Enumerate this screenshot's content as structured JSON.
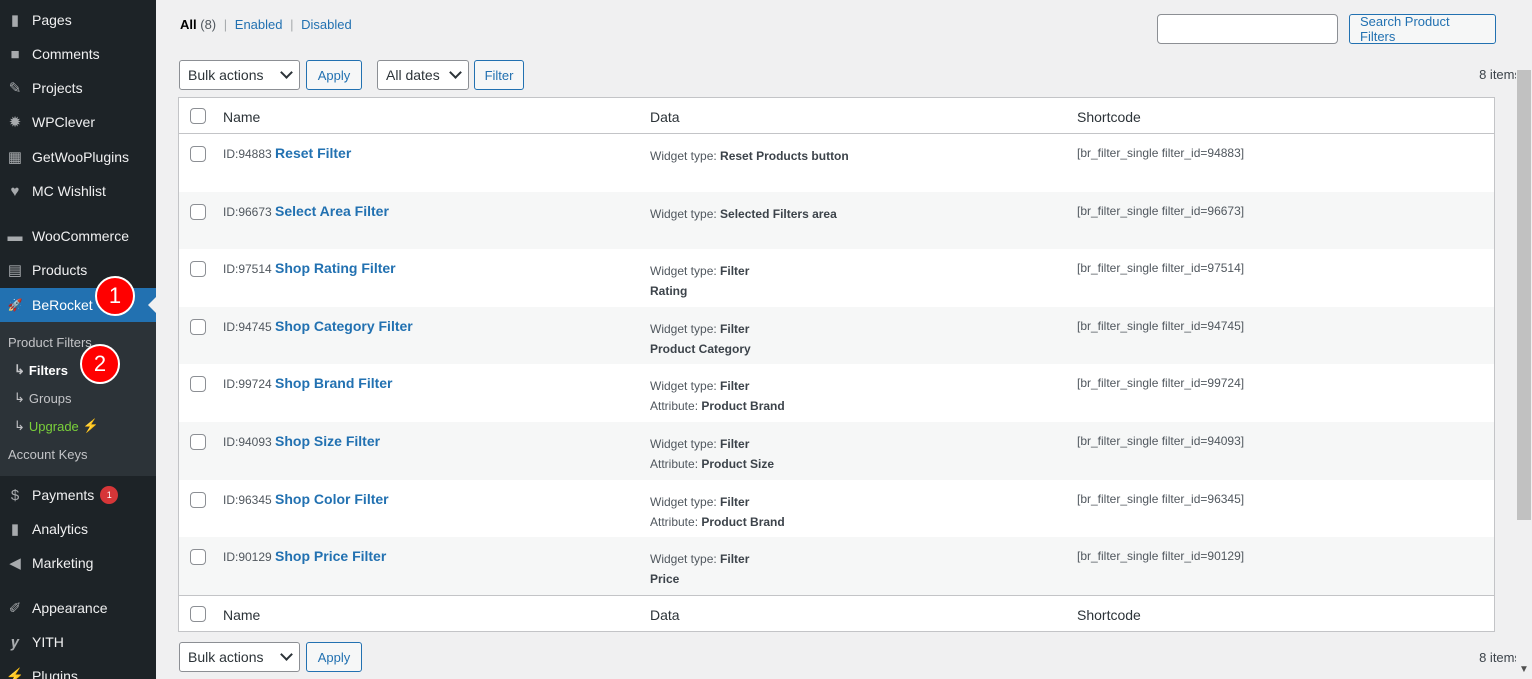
{
  "sidebar": {
    "items": [
      {
        "label": "Pages",
        "icon": "pages-icon",
        "glyph": "▮"
      },
      {
        "label": "Comments",
        "icon": "comments-icon",
        "glyph": "■"
      },
      {
        "label": "Projects",
        "icon": "pin-icon",
        "glyph": "✎"
      },
      {
        "label": "WPClever",
        "icon": "bulb-icon",
        "glyph": "✹"
      },
      {
        "label": "GetWooPlugins",
        "icon": "plugin-grid-icon",
        "glyph": "▦"
      },
      {
        "label": "MC Wishlist",
        "icon": "heart-icon",
        "glyph": "♥"
      },
      {
        "label": "WooCommerce",
        "icon": "woo-icon",
        "glyph": "▬"
      },
      {
        "label": "Products",
        "icon": "archive-icon",
        "glyph": "▤"
      },
      {
        "label": "BeRocket",
        "icon": "rocket-icon",
        "glyph": "🚀"
      },
      {
        "label": "Payments",
        "icon": "dollar-icon",
        "glyph": "$",
        "badge": "1"
      },
      {
        "label": "Analytics",
        "icon": "bar-chart-icon",
        "glyph": "▮"
      },
      {
        "label": "Marketing",
        "icon": "megaphone-icon",
        "glyph": "◀"
      },
      {
        "label": "Appearance",
        "icon": "brush-icon",
        "glyph": "✐"
      },
      {
        "label": "YITH",
        "icon": "yith-icon",
        "glyph": "𝒚"
      },
      {
        "label": "Plugins",
        "icon": "plug-icon",
        "glyph": "⚡"
      }
    ],
    "submenu": {
      "product_filters": "Product Filters",
      "filters": "Filters",
      "groups": "Groups",
      "upgrade": "Upgrade",
      "upgrade_bolt": "⚡",
      "account_keys": "Account Keys",
      "arrow": "↳"
    },
    "markers": [
      "1",
      "2"
    ]
  },
  "views": {
    "all": "All",
    "all_count": "(8)",
    "sep": "|",
    "enabled": "Enabled",
    "disabled": "Disabled"
  },
  "search": {
    "placeholder": "",
    "button": "Search Product Filters"
  },
  "toolbar": {
    "bulk_actions": "Bulk actions",
    "apply": "Apply",
    "all_dates": "All dates",
    "filter": "Filter",
    "items_count": "8 items"
  },
  "table": {
    "columns": {
      "name": "Name",
      "data": "Data",
      "shortcode": "Shortcode"
    },
    "widget_type_label": "Widget type:",
    "rows": [
      {
        "id": "ID:94883",
        "name": "Reset Filter",
        "widget_type": "Reset Products button",
        "line2_label": "",
        "line2_value": "",
        "shortcode": "[br_filter_single filter_id=94883]"
      },
      {
        "id": "ID:96673",
        "name": "Select Area Filter",
        "widget_type": "Selected Filters area",
        "line2_label": "",
        "line2_value": "",
        "shortcode": "[br_filter_single filter_id=96673]"
      },
      {
        "id": "ID:97514",
        "name": "Shop Rating Filter",
        "widget_type": "Filter",
        "line2_label": "",
        "line2_value": "Rating",
        "shortcode": "[br_filter_single filter_id=97514]"
      },
      {
        "id": "ID:94745",
        "name": "Shop Category Filter",
        "widget_type": "Filter",
        "line2_label": "",
        "line2_value": "Product Category",
        "shortcode": "[br_filter_single filter_id=94745]"
      },
      {
        "id": "ID:99724",
        "name": "Shop Brand Filter",
        "widget_type": "Filter",
        "line2_label": "Attribute:",
        "line2_value": "Product Brand",
        "shortcode": "[br_filter_single filter_id=99724]"
      },
      {
        "id": "ID:94093",
        "name": "Shop Size Filter",
        "widget_type": "Filter",
        "line2_label": "Attribute:",
        "line2_value": "Product Size",
        "shortcode": "[br_filter_single filter_id=94093]"
      },
      {
        "id": "ID:96345",
        "name": "Shop Color Filter",
        "widget_type": "Filter",
        "line2_label": "Attribute:",
        "line2_value": "Product Brand",
        "shortcode": "[br_filter_single filter_id=96345]"
      },
      {
        "id": "ID:90129",
        "name": "Shop Price Filter",
        "widget_type": "Filter",
        "line2_label": "",
        "line2_value": "Price",
        "shortcode": "[br_filter_single filter_id=90129]"
      }
    ]
  },
  "colors": {
    "accent": "#2271b1",
    "sidebar_bg": "#1d2327",
    "marker": "#ff0000"
  },
  "scrollbar": {
    "down_arrow": "▼"
  }
}
